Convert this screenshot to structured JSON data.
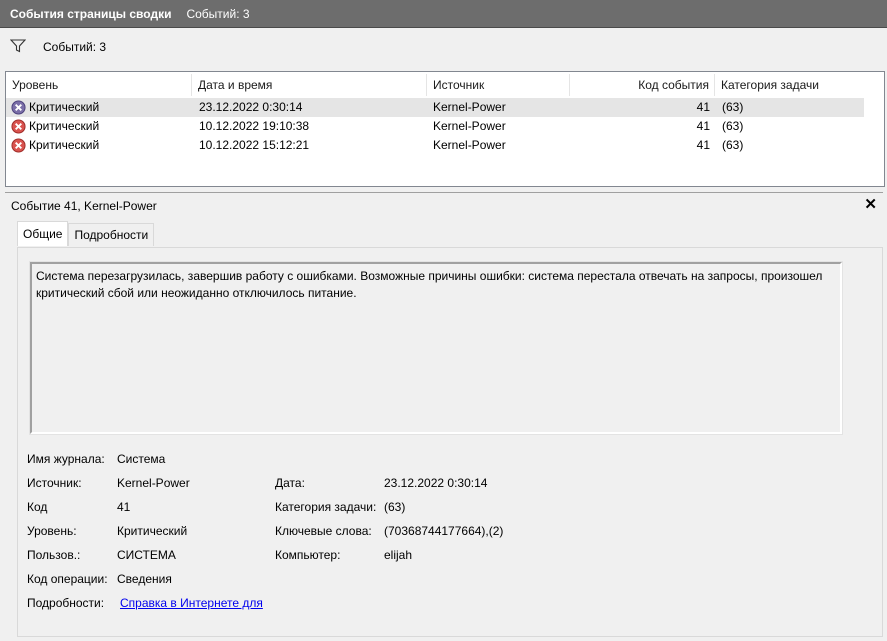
{
  "titlebar": {
    "title": "События страницы сводки",
    "count": "Событий: 3"
  },
  "filter": {
    "count": "Событий: 3"
  },
  "list": {
    "columns": [
      "Уровень",
      "Дата и время",
      "Источник",
      "Код события",
      "Категория задачи"
    ],
    "rows": [
      {
        "level": "Критический",
        "datetime": "23.12.2022 0:30:14",
        "source": "Kernel-Power",
        "code": "41",
        "category": "(63)"
      },
      {
        "level": "Критический",
        "datetime": "10.12.2022 19:10:38",
        "source": "Kernel-Power",
        "code": "41",
        "category": "(63)"
      },
      {
        "level": "Критический",
        "datetime": "10.12.2022 15:12:21",
        "source": "Kernel-Power",
        "code": "41",
        "category": "(63)"
      }
    ]
  },
  "details": {
    "title": "Событие 41, Kernel-Power",
    "tabs": [
      "Общие",
      "Подробности"
    ],
    "description": "Система перезагрузилась, завершив работу с ошибками. Возможные причины ошибки: система перестала отвечать на запросы, произошел критический сбой или неожиданно отключилось питание.",
    "fields": {
      "log_label": "Имя журнала:",
      "log_value": "Система",
      "source_label": "Источник:",
      "source_value": "Kernel-Power",
      "date_label": "Дата:",
      "date_value": "23.12.2022 0:30:14",
      "code_label": "Код",
      "code_value": "41",
      "category_label": "Категория задачи:",
      "category_value": "(63)",
      "level_label": "Уровень:",
      "level_value": "Критический",
      "keywords_label": "Ключевые слова:",
      "keywords_value": "(70368744177664),(2)",
      "user_label": "Пользов.:",
      "user_value": "СИСТЕМА",
      "computer_label": "Компьютер:",
      "computer_value": "elijah",
      "opcode_label": "Код операции:",
      "opcode_value": "Сведения",
      "more_label": "Подробности:",
      "more_link": "Справка в Интернете для"
    }
  },
  "colors": {
    "titlebar": "#6d6d6d",
    "error": "#d32f2f",
    "link": "#0000ee"
  },
  "icons": {
    "filter": "filter-icon",
    "error": "error-icon",
    "close": "close-icon"
  }
}
